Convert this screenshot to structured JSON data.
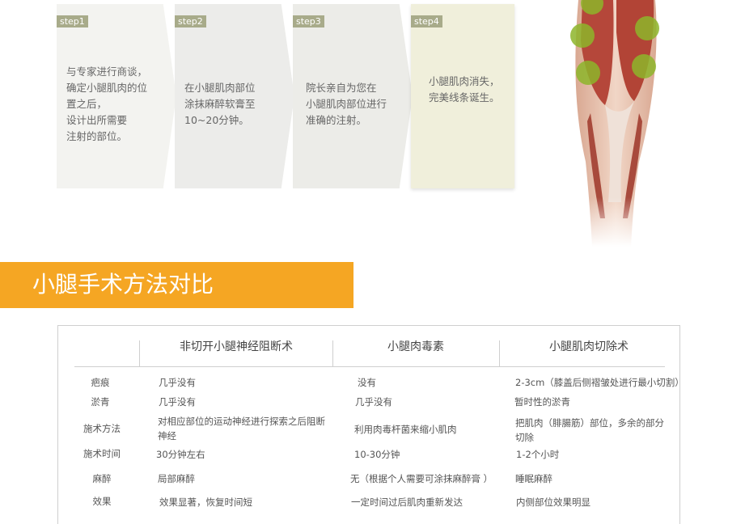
{
  "steps": [
    {
      "tag": "step1",
      "text": "与专家进行商谈，\n确定小腿肌肉的位\n置之后，\n设计出所需要\n注射的部位。",
      "bg": "#f3f3f0"
    },
    {
      "tag": "step2",
      "text": "在小腿肌肉部位\n涂抹麻醉软膏至\n10~20分钟。",
      "bg": "#ececea"
    },
    {
      "tag": "step3",
      "text": "院长亲自为您在\n小腿肌肉部位进行\n准确的注射。",
      "bg": "#ecece8"
    },
    {
      "tag": "step4",
      "text": "小腿肌肉消失，\n完美线条诞生。",
      "bg": "#f0efdb"
    }
  ],
  "section": {
    "title": "小腿手术方法对比",
    "accent": "#f5a623"
  },
  "table": {
    "headers": [
      "非切开小腿神经阻断术",
      "小腿肉毒素",
      "小腿肌肉切除术"
    ],
    "rows": [
      {
        "label": "疤痕",
        "c1": "几乎没有",
        "c2": "没有",
        "c3": "2-3cm（膝盖后侧褶皱处进行最小切割）"
      },
      {
        "label": "淤青",
        "c1": "几乎没有",
        "c2": "几乎没有",
        "c3": "暂时性的淤青"
      },
      {
        "label": "施术方法",
        "c1": "对相应部位的运动神经进行探索之后阻断神经",
        "c2": "利用肉毒杆菌来缩小肌肉",
        "c3": "把肌肉（腓腸筋）部位，多余的部分切除"
      },
      {
        "label": "施术时间",
        "c1": "30分钟左右",
        "c2": "10-30分钟",
        "c3": "1-2个小时"
      },
      {
        "label": "麻醉",
        "c1": "局部麻醉",
        "c2": "无（根据个人需要可涂抹麻醉膏 ）",
        "c3": "睡眠麻醉"
      },
      {
        "label": "效果",
        "c1": "效果显著，恢复时间短",
        "c2": "一定时间过后肌肉重新发达",
        "c3": "内侧部位效果明显"
      }
    ]
  }
}
